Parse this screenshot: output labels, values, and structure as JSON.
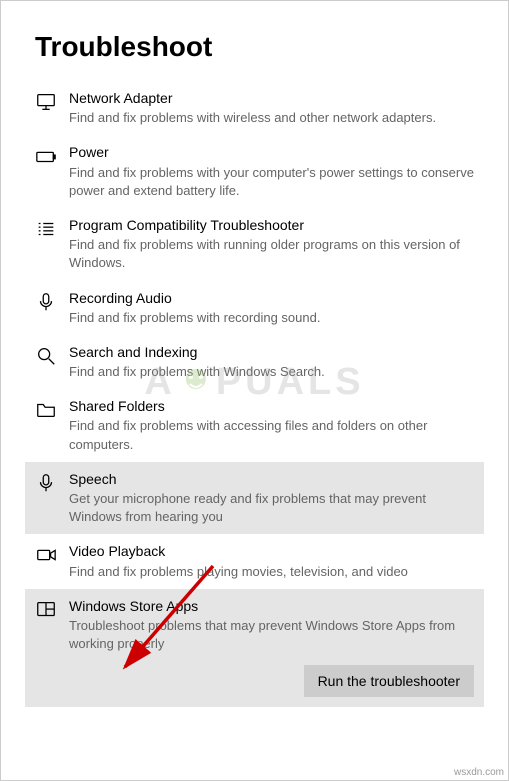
{
  "page_title": "Troubleshoot",
  "items": [
    {
      "title": "Network Adapter",
      "desc": "Find and fix problems with wireless and other network adapters."
    },
    {
      "title": "Power",
      "desc": "Find and fix problems with your computer's power settings to conserve power and extend battery life."
    },
    {
      "title": "Program Compatibility Troubleshooter",
      "desc": "Find and fix problems with running older programs on this version of Windows."
    },
    {
      "title": "Recording Audio",
      "desc": "Find and fix problems with recording sound."
    },
    {
      "title": "Search and Indexing",
      "desc": "Find and fix problems with Windows Search."
    },
    {
      "title": "Shared Folders",
      "desc": "Find and fix problems with accessing files and folders on other computers."
    },
    {
      "title": "Speech",
      "desc": "Get your microphone ready and fix problems that may prevent Windows from hearing you"
    },
    {
      "title": "Video Playback",
      "desc": "Find and fix problems playing movies, television, and video"
    },
    {
      "title": "Windows Store Apps",
      "desc": "Troubleshoot problems that may prevent Windows Store Apps from working properly"
    }
  ],
  "run_button_label": "Run the troubleshooter",
  "watermark_text_left": "A",
  "watermark_text_right": "PUALS",
  "corner_text": "wsxdn.com"
}
